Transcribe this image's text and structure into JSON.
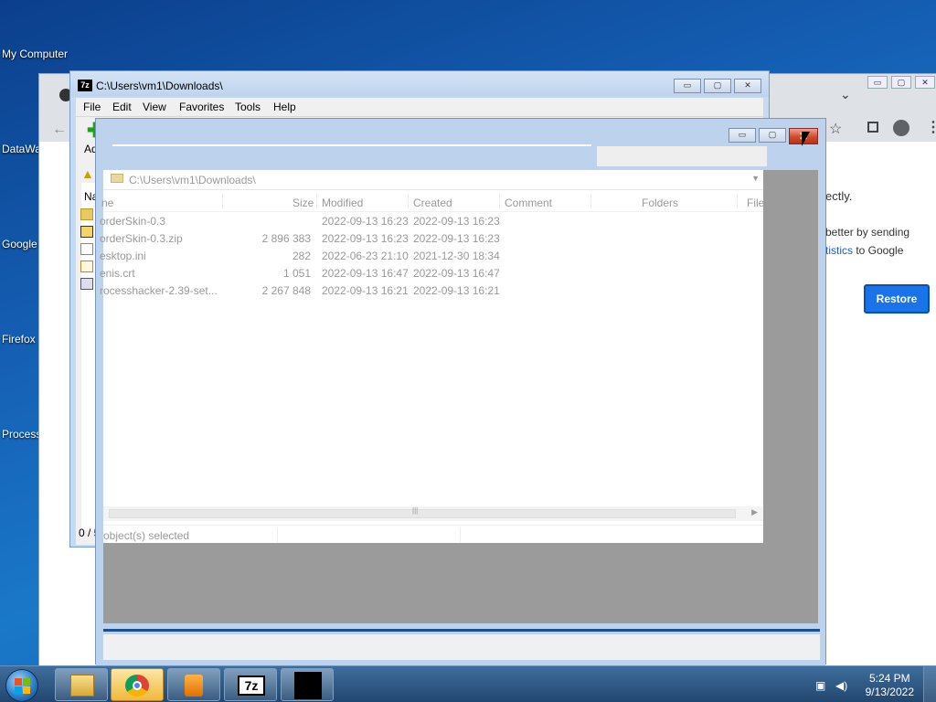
{
  "desktop": {
    "icons": [
      "My Computer",
      "DataWa",
      "Google",
      "Firefox",
      "Process"
    ]
  },
  "chrome": {
    "message_1": "ectly.",
    "message_2": "better by sending",
    "message_3_link": "tistics",
    "message_3_rest": " to Google",
    "restore_label": "Restore",
    "close_glyph": "✕",
    "ctl_minimize": "▭",
    "ctl_maximize": "▢",
    "ctl_close": "✕",
    "chevron": "⌄",
    "star": "☆",
    "more": "⋮"
  },
  "sevenzip": {
    "title": "C:\\Users\\vm1\\Downloads\\",
    "logo": "7z",
    "menu": [
      "File",
      "Edit",
      "View",
      "Favorites",
      "Tools",
      "Help"
    ],
    "add_partial": "Ad",
    "name_partial": "Na",
    "status_partial": "0 / 5",
    "ctl_minimize": "▭",
    "ctl_maximize": "▢",
    "ctl_close": "✕"
  },
  "ghost": {
    "path": "C:\\Users\\vm1\\Downloads\\",
    "columns": [
      "ne",
      "Size",
      "Modified",
      "Created",
      "Comment",
      "Folders",
      "File"
    ],
    "rows": [
      {
        "name": "orderSkin-0.3",
        "size": "",
        "modified": "2022-09-13 16:23",
        "created": "2022-09-13 16:23",
        "icon": "folder-icon"
      },
      {
        "name": "orderSkin-0.3.zip",
        "size": "2 896 383",
        "modified": "2022-09-13 16:23",
        "created": "2022-09-13 16:23",
        "icon": "zip-icon"
      },
      {
        "name": "esktop.ini",
        "size": "282",
        "modified": "2022-06-23 21:10",
        "created": "2021-12-30 18:34",
        "icon": "settings-file-icon"
      },
      {
        "name": "enis.crt",
        "size": "1 051",
        "modified": "2022-09-13 16:47",
        "created": "2022-09-13 16:47",
        "icon": "certificate-icon"
      },
      {
        "name": "rocesshacker-2.39-set...",
        "size": "2 267 848",
        "modified": "2022-09-13 16:21",
        "created": "2022-09-13 16:21",
        "icon": "installer-icon"
      }
    ],
    "status": "object(s) selected",
    "ctl_minimize": "▭",
    "ctl_maximize": "▢",
    "ctl_close": "✕"
  },
  "taskbar": {
    "apps": [
      "explorer-icon",
      "chrome-icon",
      "media-player-icon",
      "7zip-icon",
      "console-icon"
    ],
    "sevenzip_label": "7z",
    "time": "5:24 PM",
    "date": "9/13/2022",
    "colors": {
      "start": "#2f7fc8",
      "chrome_red": "#db4437",
      "chrome_green": "#0f9d58",
      "chrome_yellow": "#f4b400",
      "chrome_blue": "#4285f4"
    }
  }
}
